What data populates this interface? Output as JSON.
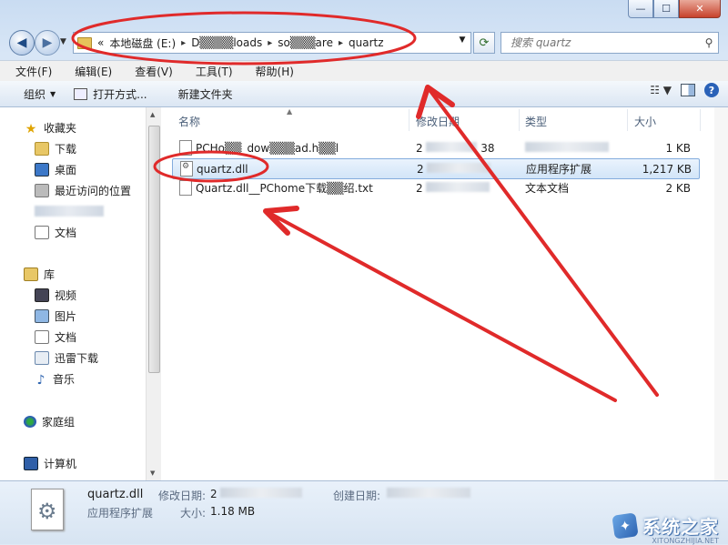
{
  "window": {
    "caption_buttons": [
      {
        "name": "minimize",
        "glyph": "—"
      },
      {
        "name": "maximize",
        "glyph": "☐"
      },
      {
        "name": "close",
        "glyph": "✕"
      }
    ]
  },
  "nav": {
    "back_glyph": "◀",
    "forward_glyph": "▶",
    "address": {
      "overflow": "«",
      "crumbs": [
        "本地磁盘 (E:)",
        "D▒▒▒▒loads",
        "so▒▒▒are",
        "quartz"
      ]
    },
    "refresh_glyph": "⟳",
    "search_placeholder": "搜索 quartz"
  },
  "menu": [
    "文件(F)",
    "编辑(E)",
    "查看(V)",
    "工具(T)",
    "帮助(H)"
  ],
  "toolbar": {
    "organize": "组织",
    "open_with": "打开方式...",
    "new_folder": "新建文件夹"
  },
  "sidebar": {
    "favorites_label": "收藏夹",
    "favorites": [
      "下载",
      "桌面",
      "最近访问的位置",
      "",
      "文档"
    ],
    "libraries_label": "库",
    "libraries": [
      "视频",
      "图片",
      "文档",
      "迅雷下载",
      "音乐"
    ],
    "homegroup_label": "家庭组",
    "computer_label": "计算机"
  },
  "columns": {
    "name": "名称",
    "modified": "修改日期",
    "type": "类型",
    "size": "大小"
  },
  "files": [
    {
      "name": "PCHo▒▒_dow▒▒▒ad.h▒▒l",
      "date_prefix": "2",
      "date_suffix": "38",
      "type": "",
      "size": "1 KB"
    },
    {
      "name": "quartz.dll",
      "date_prefix": "2",
      "date_suffix": "",
      "type": "应用程序扩展",
      "size": "1,217 KB"
    },
    {
      "name": "Quartz.dll__PChome下载▒▒绍.txt",
      "date_prefix": "2",
      "date_suffix": "",
      "type": "文本文档",
      "size": "2 KB"
    }
  ],
  "details": {
    "file_name": "quartz.dll",
    "file_type": "应用程序扩展",
    "modified_label": "修改日期:",
    "modified_value_visible": "2",
    "created_label": "创建日期:",
    "size_label": "大小:",
    "size_value": "1.18 MB"
  },
  "watermark": {
    "text": "系统之家",
    "url": "XITONGZHIJIA.NET"
  },
  "colors": {
    "annotation_red": "#e02a2a",
    "selection_border": "#84acdd",
    "accent": "#2a62b8"
  }
}
